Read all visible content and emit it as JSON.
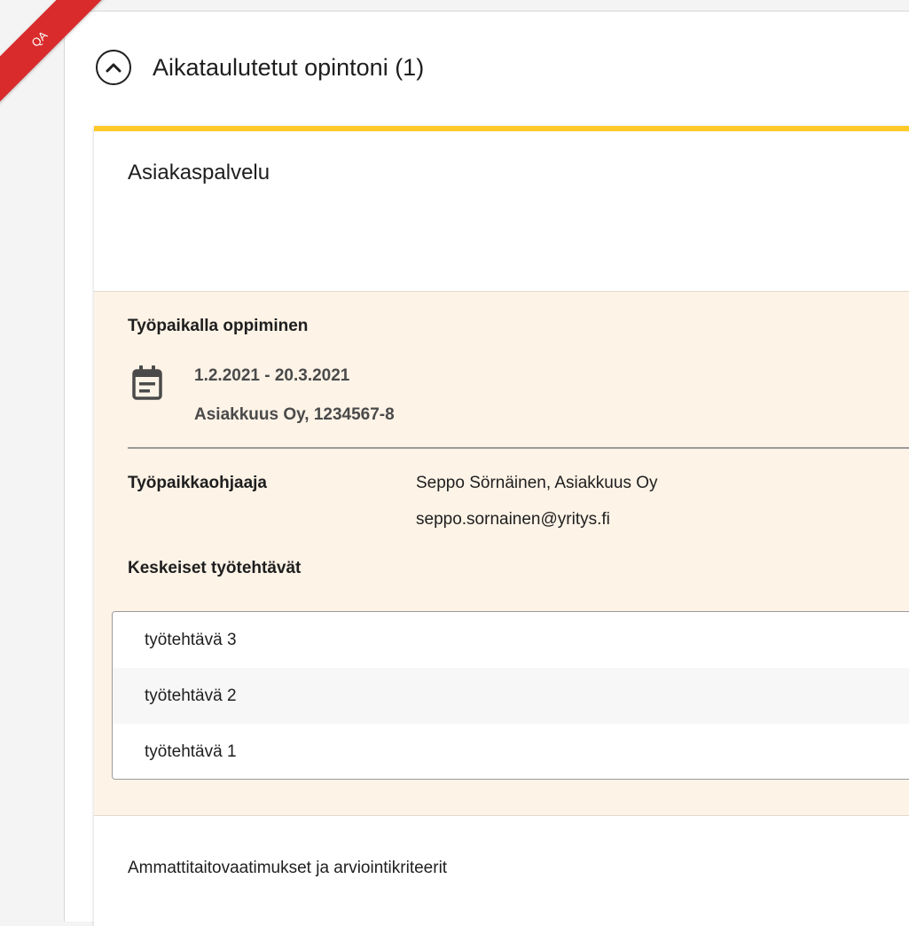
{
  "ribbon": {
    "label": "QA",
    "color": "#d92b2b"
  },
  "section": {
    "title": "Aikataulutetut opintoni (1)",
    "toggle_icon": "chevron-up-icon"
  },
  "card": {
    "title": "Asiakaspalvelu",
    "accent_color": "#ffc928",
    "workplace_learning": {
      "heading": "Työpaikalla oppiminen",
      "icon": "calendar-icon",
      "dates": "1.2.2021 - 20.3.2021",
      "company": "Asiakkuus Oy, 1234567-8",
      "supervisor_label": "Työpaikkaohjaaja",
      "supervisor_name": "Seppo Sörnäinen, Asiakkuus Oy",
      "supervisor_email": "seppo.sornainen@yritys.fi",
      "tasks_heading": "Keskeiset työtehtävät",
      "tasks": [
        "työtehtävä 3",
        "työtehtävä 2",
        "työtehtävä 1"
      ],
      "background_color": "#fdf3e7"
    },
    "skills_link": "Ammattitaitovaatimukset ja arviointikriteerit"
  }
}
